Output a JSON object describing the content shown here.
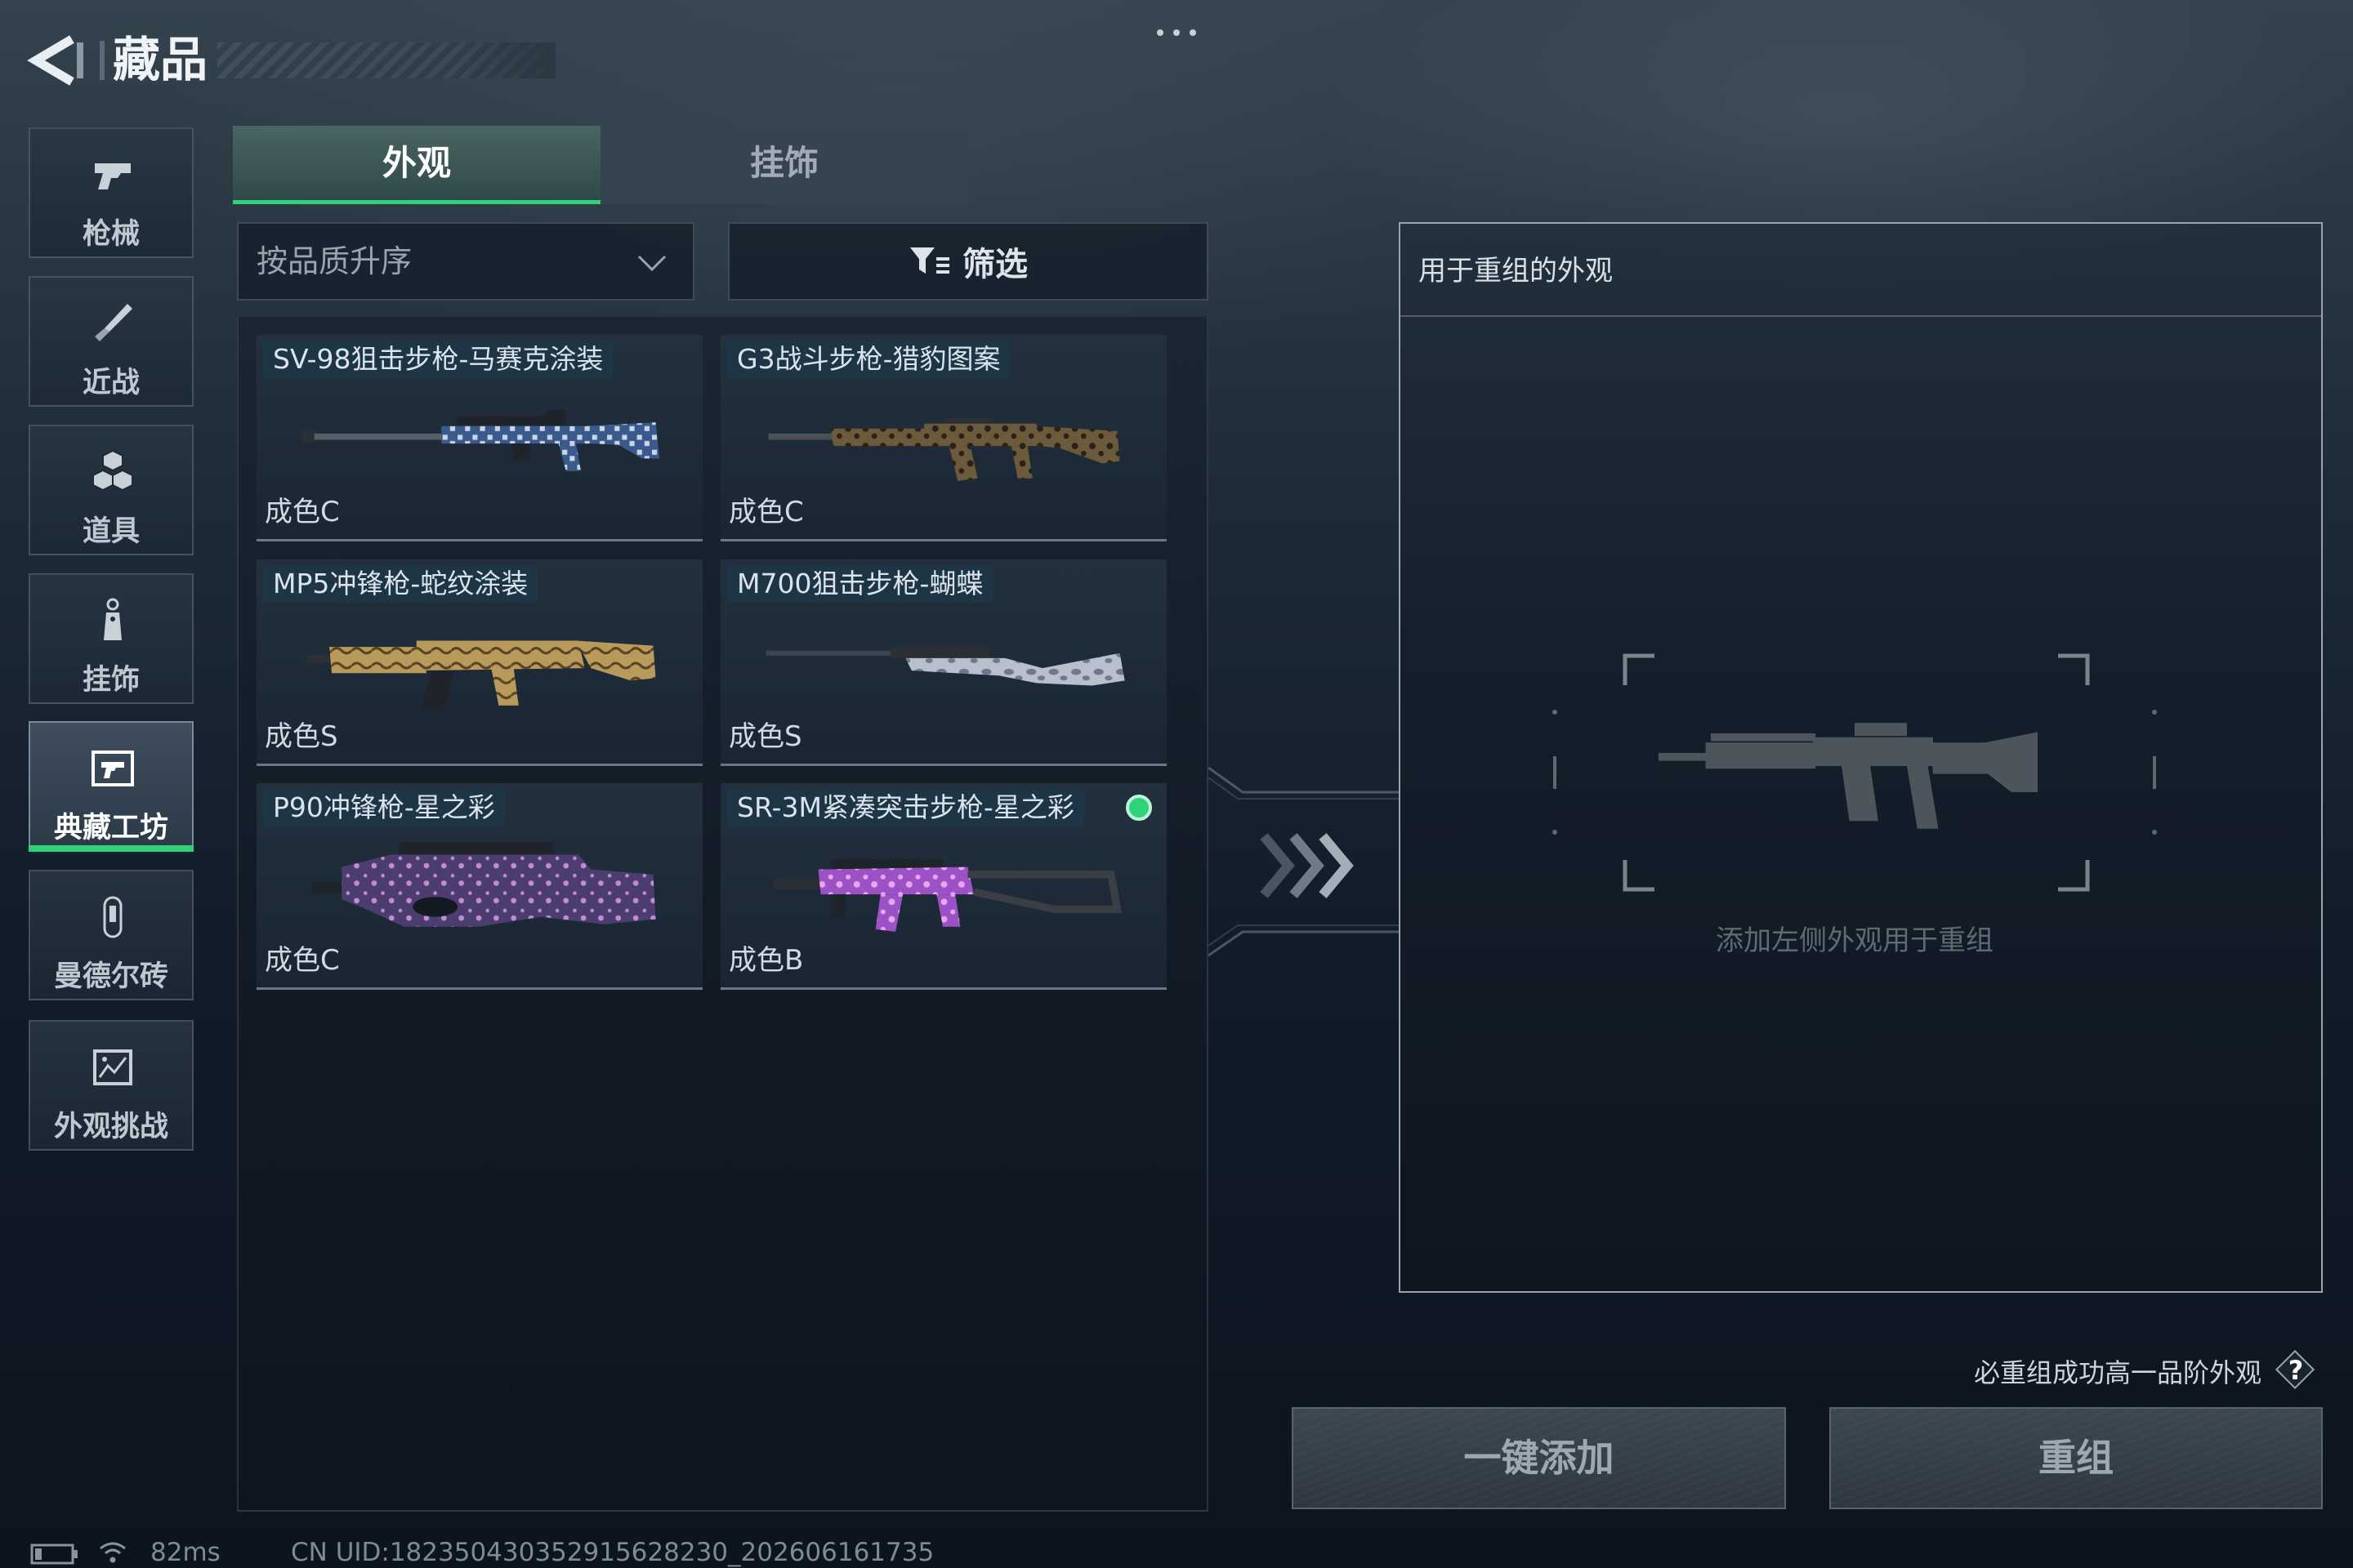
{
  "header": {
    "title": "藏品",
    "back_icon": "back-arrow-icon",
    "more_icon": "more-dots-icon"
  },
  "sidebar": {
    "items": [
      {
        "label": "枪械",
        "icon": "gun-icon",
        "active": false
      },
      {
        "label": "近战",
        "icon": "knife-icon",
        "active": false
      },
      {
        "label": "道具",
        "icon": "items-icon",
        "active": false
      },
      {
        "label": "挂饰",
        "icon": "charm-icon",
        "active": false
      },
      {
        "label": "典藏工坊",
        "icon": "workshop-icon",
        "active": true
      },
      {
        "label": "曼德尔砖",
        "icon": "brick-icon",
        "active": false
      },
      {
        "label": "外观挑战",
        "icon": "challenge-icon",
        "active": false
      }
    ]
  },
  "tabs": [
    {
      "label": "外观",
      "active": true
    },
    {
      "label": "挂饰",
      "active": false
    }
  ],
  "sort": {
    "selected": "按品质升序",
    "icon": "chevron-down-icon"
  },
  "filter": {
    "label": "筛选",
    "icon": "filter-icon"
  },
  "skins": [
    {
      "name": "SV-98狙击步枪-马赛克涂装",
      "quality": "成色C",
      "color": "#3b5a8c",
      "accent": "#c9d6ea",
      "marked": false
    },
    {
      "name": "G3战斗步枪-猎豹图案",
      "quality": "成色C",
      "color": "#6b5a3c",
      "accent": "#2a2218",
      "marked": false
    },
    {
      "name": "MP5冲锋枪-蛇纹涂装",
      "quality": "成色S",
      "color": "#b89a5a",
      "accent": "#5a4322",
      "marked": false
    },
    {
      "name": "M700狙击步枪-蝴蝶",
      "quality": "成色S",
      "color": "#b9c0cc",
      "accent": "#6e7890",
      "marked": false
    },
    {
      "name": "P90冲锋枪-星之彩",
      "quality": "成色C",
      "color": "#4b3d6e",
      "accent": "#c48ad8",
      "marked": false
    },
    {
      "name": "SR-3M紧凑突击步枪-星之彩",
      "quality": "成色B",
      "color": "#9a52c4",
      "accent": "#e6a6f2",
      "marked": true
    }
  ],
  "recombine": {
    "panel_title": "用于重组的外观",
    "placeholder": "添加左侧外观用于重组",
    "arrow_icon": "triple-chevron-right-icon",
    "guarantee_text": "必重组成功高一品阶外观",
    "help_icon": "question-icon",
    "help_glyph": "?",
    "add_all_label": "一键添加",
    "recombine_label": "重组"
  },
  "status": {
    "battery_icon": "battery-icon",
    "wifi_icon": "wifi-icon",
    "ping": "82ms",
    "uid": "CN UID:182350430352915628230_202606161735"
  },
  "colors": {
    "accent": "#2fd37a",
    "indicator": "#2fd37a"
  }
}
